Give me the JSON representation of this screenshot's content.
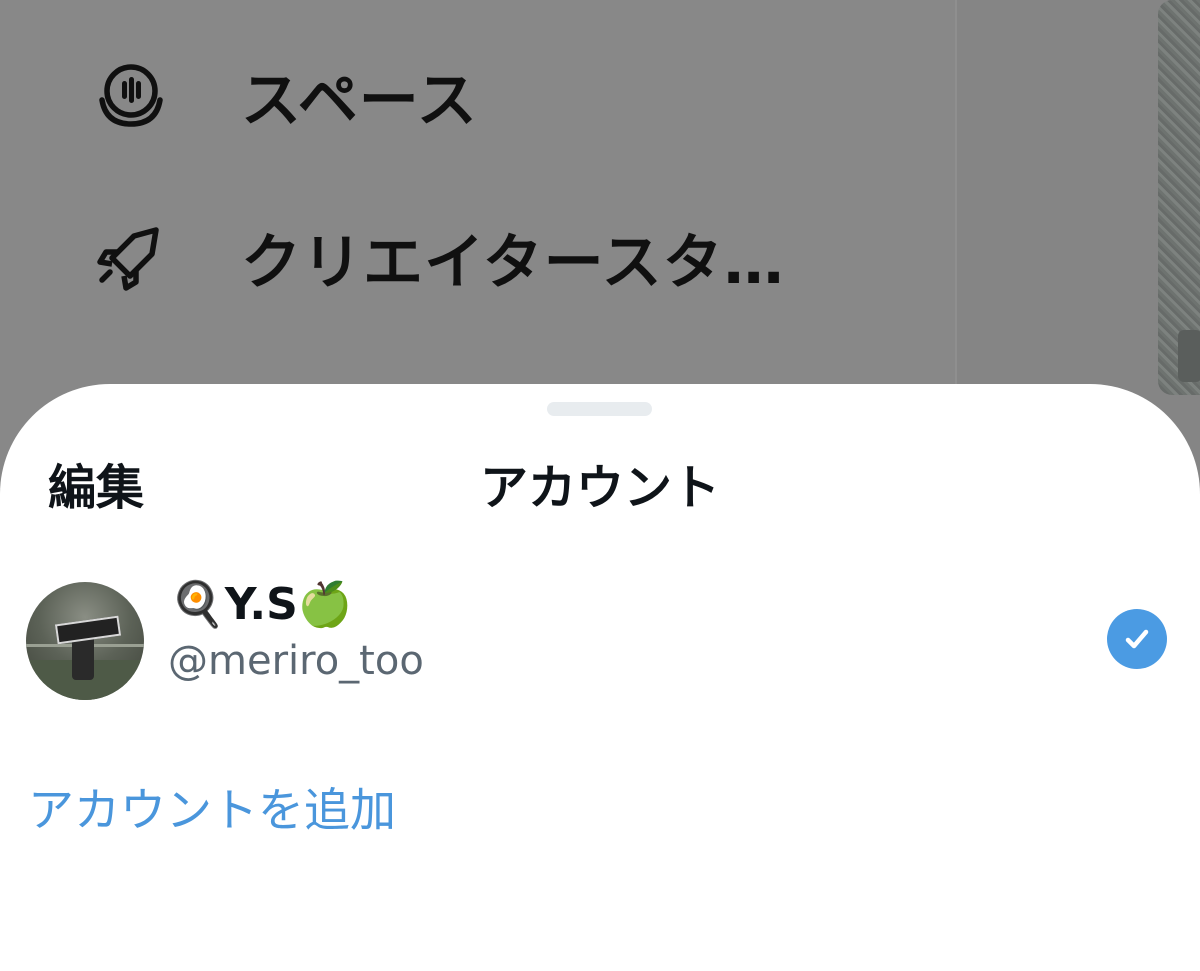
{
  "background_menu": {
    "items": [
      {
        "icon": "spaces-icon",
        "label": "スペース"
      },
      {
        "icon": "rocket-icon",
        "label": "クリエイタースタ…"
      }
    ]
  },
  "sheet": {
    "edit_label": "編集",
    "title": "アカウント",
    "account": {
      "display_name": "🍳Y.S🍏",
      "handle": "@meriro_too",
      "selected": true
    },
    "add_account_label": "アカウントを追加"
  },
  "colors": {
    "accent": "#4b9be3",
    "link": "#4a96dc",
    "text": "#0f1419",
    "secondary_text": "#5b6772",
    "overlay": "#888888"
  }
}
